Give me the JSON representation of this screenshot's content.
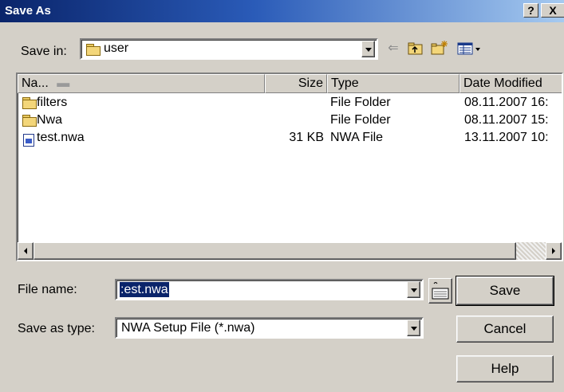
{
  "window": {
    "title": "Save As",
    "help_glyph": "?",
    "close_glyph": "X"
  },
  "save_in": {
    "label": "Save in:",
    "value": "user"
  },
  "toolbar": {
    "back_icon": "back-arrow-icon",
    "up_icon": "up-one-level-icon",
    "new_folder_icon": "new-folder-icon",
    "views_icon": "views-menu-icon"
  },
  "file_list": {
    "columns": [
      "Na...",
      "Size",
      "Type",
      "Date Modified"
    ],
    "rows": [
      {
        "icon": "folder-icon",
        "name": "filters",
        "size": "",
        "type": "File Folder",
        "date": "08.11.2007 16:"
      },
      {
        "icon": "folder-icon",
        "name": "Nwa",
        "size": "",
        "type": "File Folder",
        "date": "08.11.2007 15:"
      },
      {
        "icon": "nwa-file-icon",
        "name": "test.nwa",
        "size": "31 KB",
        "type": "NWA File",
        "date": "13.11.2007 10:"
      }
    ]
  },
  "file_name": {
    "label": "File name:",
    "value": "test.nwa",
    "visible_value": ":est.nwa"
  },
  "save_as_type": {
    "label": "Save as type:",
    "value": "NWA Setup File (*.nwa)"
  },
  "buttons": {
    "save": "Save",
    "cancel": "Cancel",
    "help": "Help"
  },
  "colors": {
    "title_bar_start": "#0a246a",
    "title_bar_end": "#a6caf0",
    "selection": "#0a246a",
    "dialog_face": "#d4d0c8"
  }
}
